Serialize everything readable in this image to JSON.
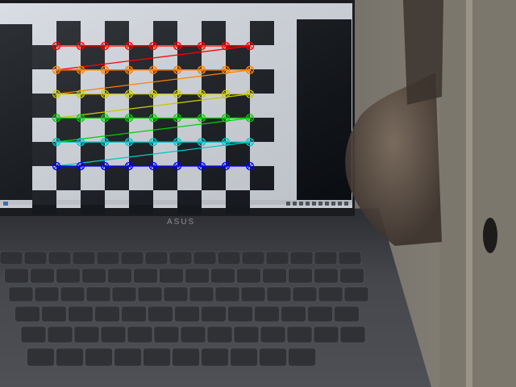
{
  "scene": {
    "description_label": "",
    "laptop_brand": "ASUS"
  },
  "checkerboard": {
    "inner_corners_cols": 9,
    "inner_corners_rows": 6,
    "detected": true
  },
  "corner_colors": [
    "#ff0000",
    "#ff8000",
    "#c8c800",
    "#00d000",
    "#00c8c8",
    "#0000ff"
  ],
  "colors": {
    "screen_bg": "#d8dde4",
    "dark_square": "#15181d",
    "side_panel": "#0c0f14",
    "laptop_body": "#44464b",
    "wall": "#5a5650"
  }
}
